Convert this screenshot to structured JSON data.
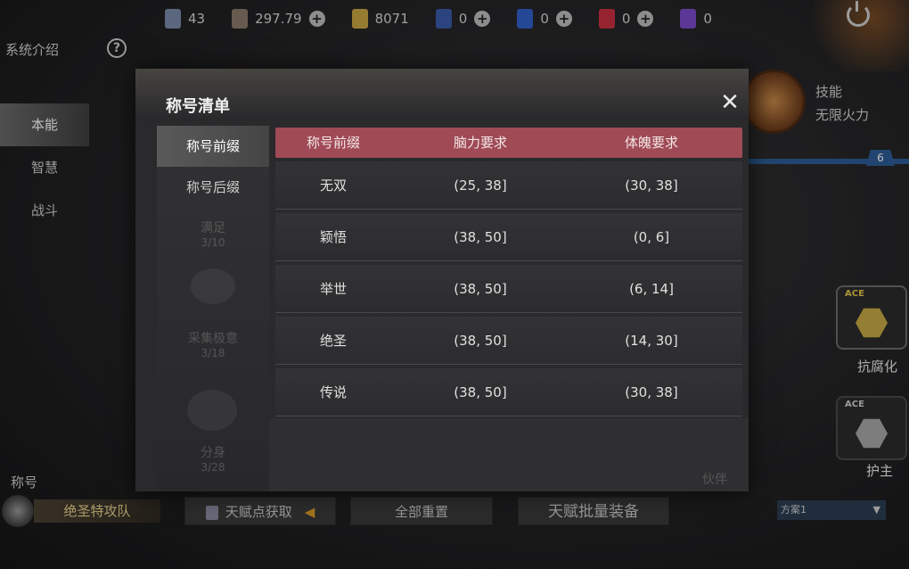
{
  "resources": [
    {
      "icon": "blue-vial-icon",
      "value": "43",
      "plus": false,
      "color": "#7a8aa8"
    },
    {
      "icon": "card-pack-icon",
      "value": "297.79",
      "plus": true,
      "color": "#8a7a6a"
    },
    {
      "icon": "gold-coin-icon",
      "value": "8071",
      "plus": false,
      "color": "#c9a642"
    },
    {
      "icon": "blue-card-icon",
      "value": "0",
      "plus": true,
      "color": "#3a5aa8"
    },
    {
      "icon": "blue-potion-icon",
      "value": "0",
      "plus": true,
      "color": "#3060c8"
    },
    {
      "icon": "red-potion-icon",
      "value": "0",
      "plus": true,
      "color": "#c83040"
    },
    {
      "icon": "purple-crystal-icon",
      "value": "0",
      "plus": false,
      "color": "#7a4ac8"
    }
  ],
  "left": {
    "system_title": "系统介绍",
    "nav": [
      "本能",
      "智慧",
      "战斗"
    ],
    "active_nav": 0
  },
  "right": {
    "skill_label": "技能",
    "skill_name": "无限火力",
    "level_badge": "6",
    "node1_label": "抗腐化",
    "node2_label": "护主",
    "ace": "ACE"
  },
  "bottom": {
    "title_label": "称号",
    "title_name": "绝圣特攻队",
    "btn_talent_points": "天赋点获取",
    "btn_reset_all": "全部重置",
    "btn_batch_equip": "天赋批量装备",
    "scheme": "方案1"
  },
  "dialog": {
    "title": "称号清单",
    "tabs": [
      "称号前缀",
      "称号后缀"
    ],
    "active_tab": 0,
    "columns": [
      "称号前缀",
      "脑力要求",
      "体魄要求"
    ],
    "rows": [
      {
        "prefix": "无双",
        "brain": "(25, 38]",
        "body": "(30, 38]"
      },
      {
        "prefix": "颖悟",
        "brain": "(38, 50]",
        "body": "(0, 6]"
      },
      {
        "prefix": "举世",
        "brain": "(38, 50]",
        "body": "(6, 14]"
      },
      {
        "prefix": "绝圣",
        "brain": "(38, 50]",
        "body": "(14, 30]"
      },
      {
        "prefix": "传说",
        "brain": "(38, 50]",
        "body": "(30, 38]"
      }
    ],
    "faded_items": [
      {
        "name": "满足",
        "count": "3/10"
      },
      {
        "name": "采集极意",
        "count": "3/18"
      },
      {
        "name": "分身",
        "count": "3/28"
      }
    ],
    "faded_partner": "伙伴"
  }
}
